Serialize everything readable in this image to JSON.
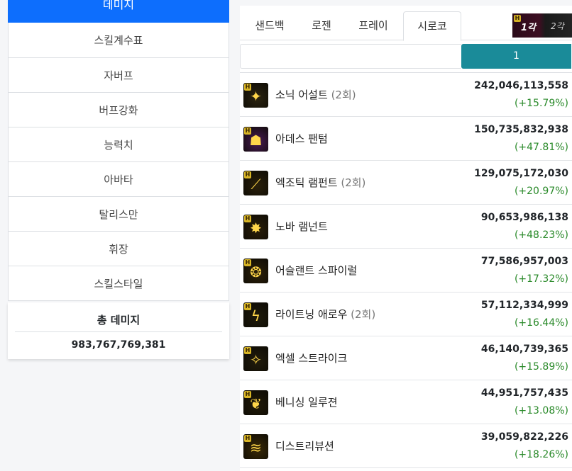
{
  "sidebar": {
    "active_label": "데미지",
    "items": [
      {
        "label": "스킬계수표"
      },
      {
        "label": "자버프"
      },
      {
        "label": "버프강화"
      },
      {
        "label": "능력치"
      },
      {
        "label": "아바타"
      },
      {
        "label": "탈리스만"
      },
      {
        "label": "휘장"
      },
      {
        "label": "스킬스타일"
      }
    ]
  },
  "total": {
    "title": "총 데미지",
    "value": "983,767,769,381"
  },
  "tabs": [
    {
      "label": "샌드백"
    },
    {
      "label": "로젠"
    },
    {
      "label": "프레이"
    },
    {
      "label": "시로코",
      "active": true
    }
  ],
  "rank_thumb": {
    "h_badge": "H",
    "first": "1각",
    "second": "2각"
  },
  "pager": {
    "current": "1"
  },
  "skills": [
    {
      "name": "소닉 어설트",
      "hits": "(2회)",
      "damage": "242,046,113,558",
      "pct": "(+15.79%)",
      "icon": "sonic-assault-icon",
      "glyph": "✦",
      "bg": "#2b2410"
    },
    {
      "name": "아데스 팬텀",
      "hits": "",
      "damage": "150,735,832,938",
      "pct": "(+47.81%)",
      "icon": "ades-phantom-icon",
      "glyph": "☗",
      "bg": "#4a1a55"
    },
    {
      "name": "엑조틱 램펀트",
      "hits": "(2회)",
      "damage": "129,075,172,030",
      "pct": "(+20.97%)",
      "icon": "exotic-rampant-icon",
      "glyph": "⟋",
      "bg": "#2a200a"
    },
    {
      "name": "노바 램넌트",
      "hits": "",
      "damage": "90,653,986,138",
      "pct": "(+48.23%)",
      "icon": "nova-remnant-icon",
      "glyph": "✸",
      "bg": "#2a1e08"
    },
    {
      "name": "어슬랜트 스파이럴",
      "hits": "",
      "damage": "77,586,957,003",
      "pct": "(+17.32%)",
      "icon": "aslant-spiral-icon",
      "glyph": "❂",
      "bg": "#2c2008"
    },
    {
      "name": "라이트닝 애로우",
      "hits": "(2회)",
      "damage": "57,112,334,999",
      "pct": "(+16.44%)",
      "icon": "lightning-arrow-icon",
      "glyph": "ϟ",
      "bg": "#1e1a0a"
    },
    {
      "name": "엑셀 스트라이크",
      "hits": "",
      "damage": "46,140,739,365",
      "pct": "(+15.89%)",
      "icon": "excel-strike-icon",
      "glyph": "✧",
      "bg": "#221c0c"
    },
    {
      "name": "베니싱 일루젼",
      "hits": "",
      "damage": "44,951,757,435",
      "pct": "(+13.08%)",
      "icon": "vanishing-illusion-icon",
      "glyph": "❦",
      "bg": "#201a08"
    },
    {
      "name": "디스트리뷰션",
      "hits": "",
      "damage": "39,059,822,226",
      "pct": "(+18.26%)",
      "icon": "distribution-icon",
      "glyph": "≋",
      "bg": "#3a2a06"
    }
  ],
  "colors": {
    "primary": "#0d6efd",
    "pager": "#1a8b99",
    "positive": "#2a8a2a"
  }
}
